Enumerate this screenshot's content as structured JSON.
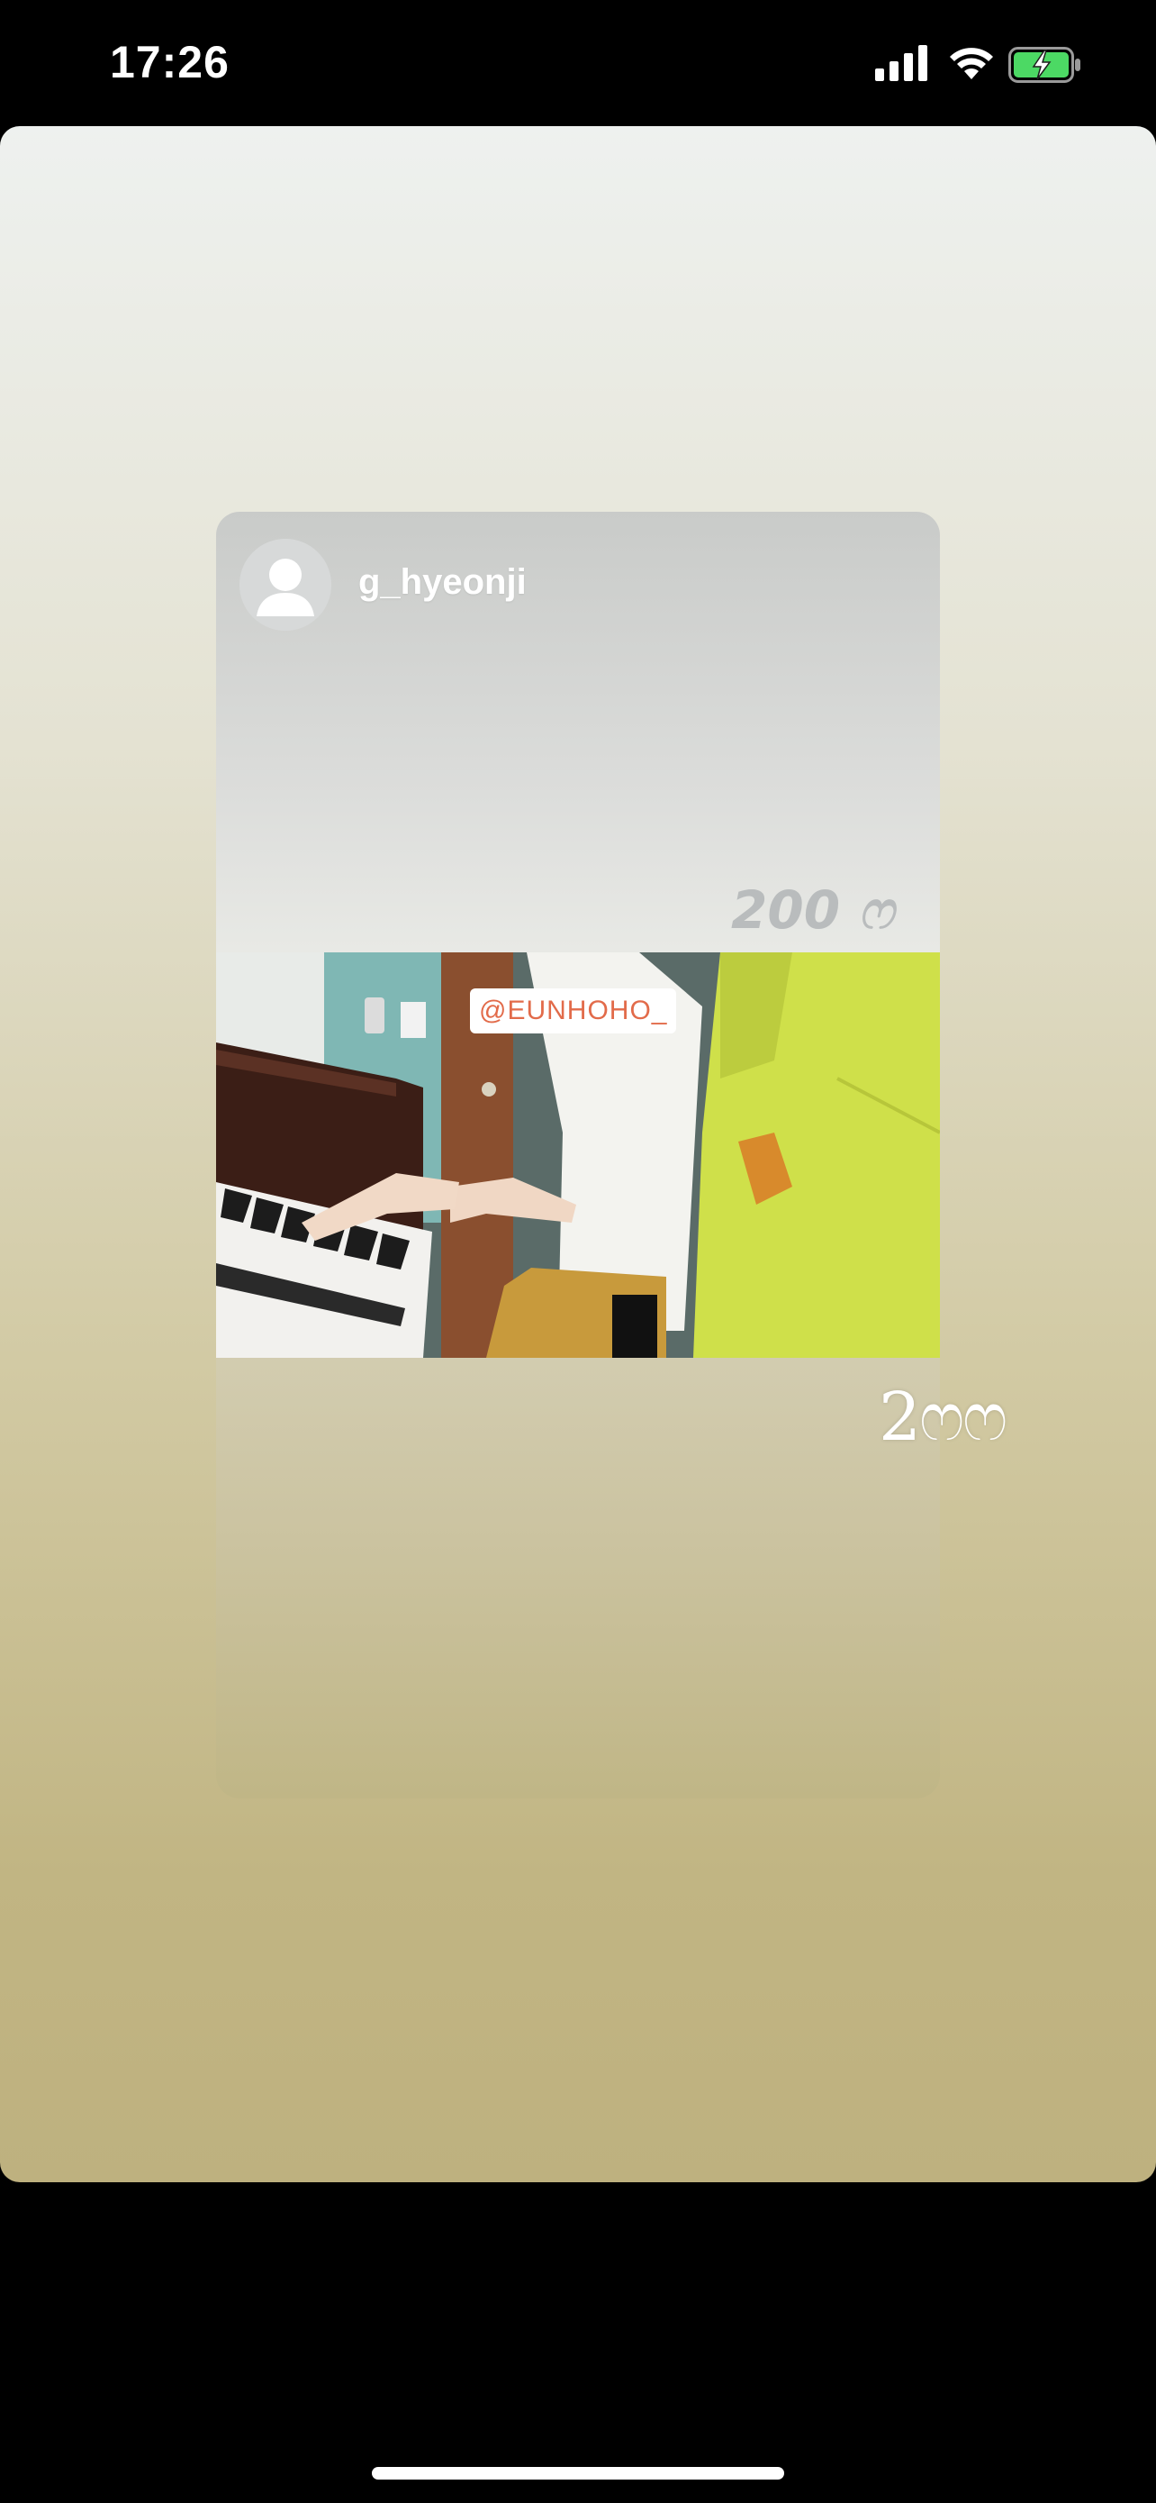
{
  "status_bar": {
    "time": "17:26",
    "icons": [
      "signal-icon",
      "wifi-icon",
      "battery-charging-icon"
    ],
    "battery_color": "#4cd964"
  },
  "story": {
    "shared_post": {
      "username": "g_hyeonji",
      "overlay_count": "200 ෆ",
      "mention_tag": "@EUNHOHO_",
      "scene": "piano-performance-video"
    },
    "handwritten_text": "2ෆෆ"
  }
}
